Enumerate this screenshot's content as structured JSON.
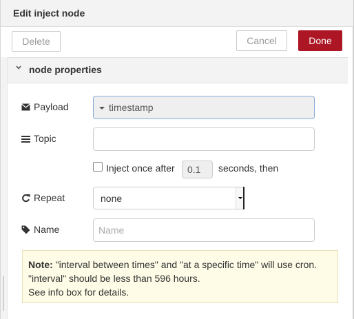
{
  "header": {
    "title": "Edit inject node"
  },
  "toolbar": {
    "delete_label": "Delete",
    "cancel_label": "Cancel",
    "done_label": "Done"
  },
  "section": {
    "label": "node properties"
  },
  "form": {
    "payload": {
      "label": "Payload",
      "type_icon": "caret-down-icon",
      "value": "timestamp",
      "icon": "envelope-icon"
    },
    "topic": {
      "label": "Topic",
      "value": "",
      "icon": "bars-icon"
    },
    "inject_once": {
      "label": "Inject once after",
      "checked": false,
      "delay": "0.1",
      "suffix": "seconds, then"
    },
    "repeat": {
      "label": "Repeat",
      "value": "none",
      "icon": "refresh-icon"
    },
    "name": {
      "label": "Name",
      "value": "",
      "placeholder": "Name",
      "icon": "tag-icon"
    }
  },
  "tip": {
    "note_label": "Note:",
    "line1": "\"interval between times\" and \"at a specific time\" will use cron.",
    "line2": "\"interval\" should be less than 596 hours.",
    "line3": "See info box for details."
  },
  "colors": {
    "done_bg": "#ad1625",
    "focus_border": "#85a9d8",
    "tip_bg": "#fefce6"
  }
}
